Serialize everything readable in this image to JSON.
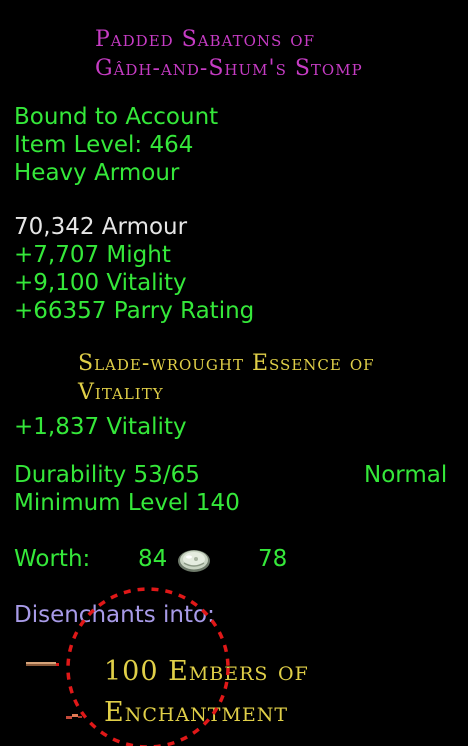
{
  "colors": {
    "title": "#c63cc4",
    "green": "#35e83a",
    "white": "#e6e6e6",
    "gold": "#e0cf48",
    "lavender": "#a89be8",
    "annotation_red": "#e01818"
  },
  "item": {
    "name_line1": "Padded Sabatons of",
    "name_line2": "Gâdh-and-Shum's Stomp",
    "binding": "Bound to Account",
    "item_level": "Item Level: 464",
    "armour_type": "Heavy Armour",
    "armour_value": "70,342 Armour",
    "stats": [
      "+7,707 Might",
      "+9,100 Vitality",
      "+66357 Parry Rating"
    ],
    "essence": {
      "name_line1": "Slade-wrought Essence of",
      "name_line2": "Vitality",
      "stat": "+1,837 Vitality"
    },
    "durability": "Durability 53/65",
    "durability_quality": "Normal",
    "minimum_level": "Minimum Level 140",
    "worth": {
      "label": "Worth:",
      "gold": "84",
      "silver": "78",
      "icon": "silver-coin-icon"
    },
    "disenchant": {
      "label": "Disenchants into:",
      "result_line1": "100 Embers of",
      "result_line2": "Enchantment",
      "icon": "ember-shard-icon"
    }
  }
}
